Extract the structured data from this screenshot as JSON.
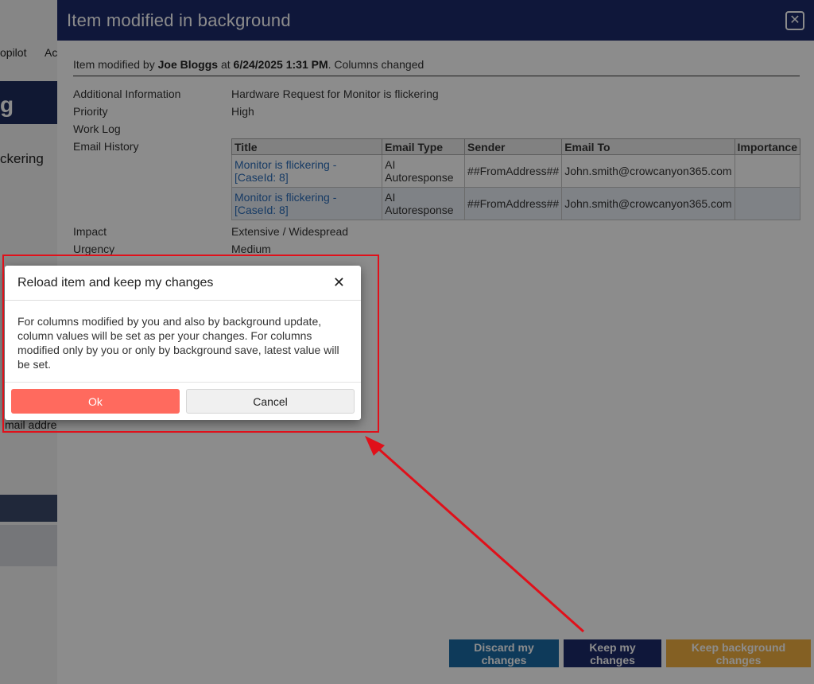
{
  "background_page": {
    "top_text_1": "opilot",
    "top_text_2": "Ac",
    "band_text": "g",
    "side_text": "ckering",
    "email_text": "mail addre"
  },
  "main_modal": {
    "title": "Item modified in background",
    "modified_prefix": "Item modified by ",
    "modified_by": "Joe Bloggs",
    "modified_at_word": " at ",
    "modified_when": "6/24/2025 1:31 PM",
    "modified_suffix": ". Columns changed",
    "fields": {
      "additional_information": {
        "label": "Additional Information",
        "value": "Hardware Request for Monitor is flickering"
      },
      "priority": {
        "label": "Priority",
        "value": "High"
      },
      "work_log": {
        "label": "Work Log",
        "value": ""
      },
      "email_history": {
        "label": "Email History"
      },
      "impact": {
        "label": "Impact",
        "value": "Extensive / Widespread"
      },
      "urgency": {
        "label": "Urgency",
        "value": "Medium"
      }
    },
    "email_table": {
      "headers": [
        "Title",
        "Email Type",
        "Sender",
        "Email To",
        "Importance"
      ],
      "rows": [
        [
          "Monitor is flickering - [CaseId: 8]",
          "AI Autoresponse",
          "##FromAddress##",
          "John.smith@crowcanyon365.com",
          ""
        ],
        [
          "Monitor is flickering - [CaseId: 8]",
          "AI Autoresponse",
          "##FromAddress##",
          "John.smith@crowcanyon365.com",
          ""
        ]
      ]
    },
    "buttons": {
      "discard": "Discard my changes",
      "keep": "Keep my changes",
      "keep_background": "Keep background changes"
    }
  },
  "confirm_dialog": {
    "title": "Reload item and keep my changes",
    "close_symbol": "✕",
    "message": "For columns modified by you and also by background update, column values will be set as per your changes. For columns modified only by you or only by background save, latest value will be set.",
    "ok_label": "Ok",
    "cancel_label": "Cancel"
  },
  "colors": {
    "header_navy": "#1d2a6a",
    "discard_blue": "#1b6aa5",
    "keep_bg_orange": "#f0b040",
    "ok_red": "#ff6a5e",
    "annotation_red": "#e0101a",
    "link_blue": "#2a6cb8"
  }
}
